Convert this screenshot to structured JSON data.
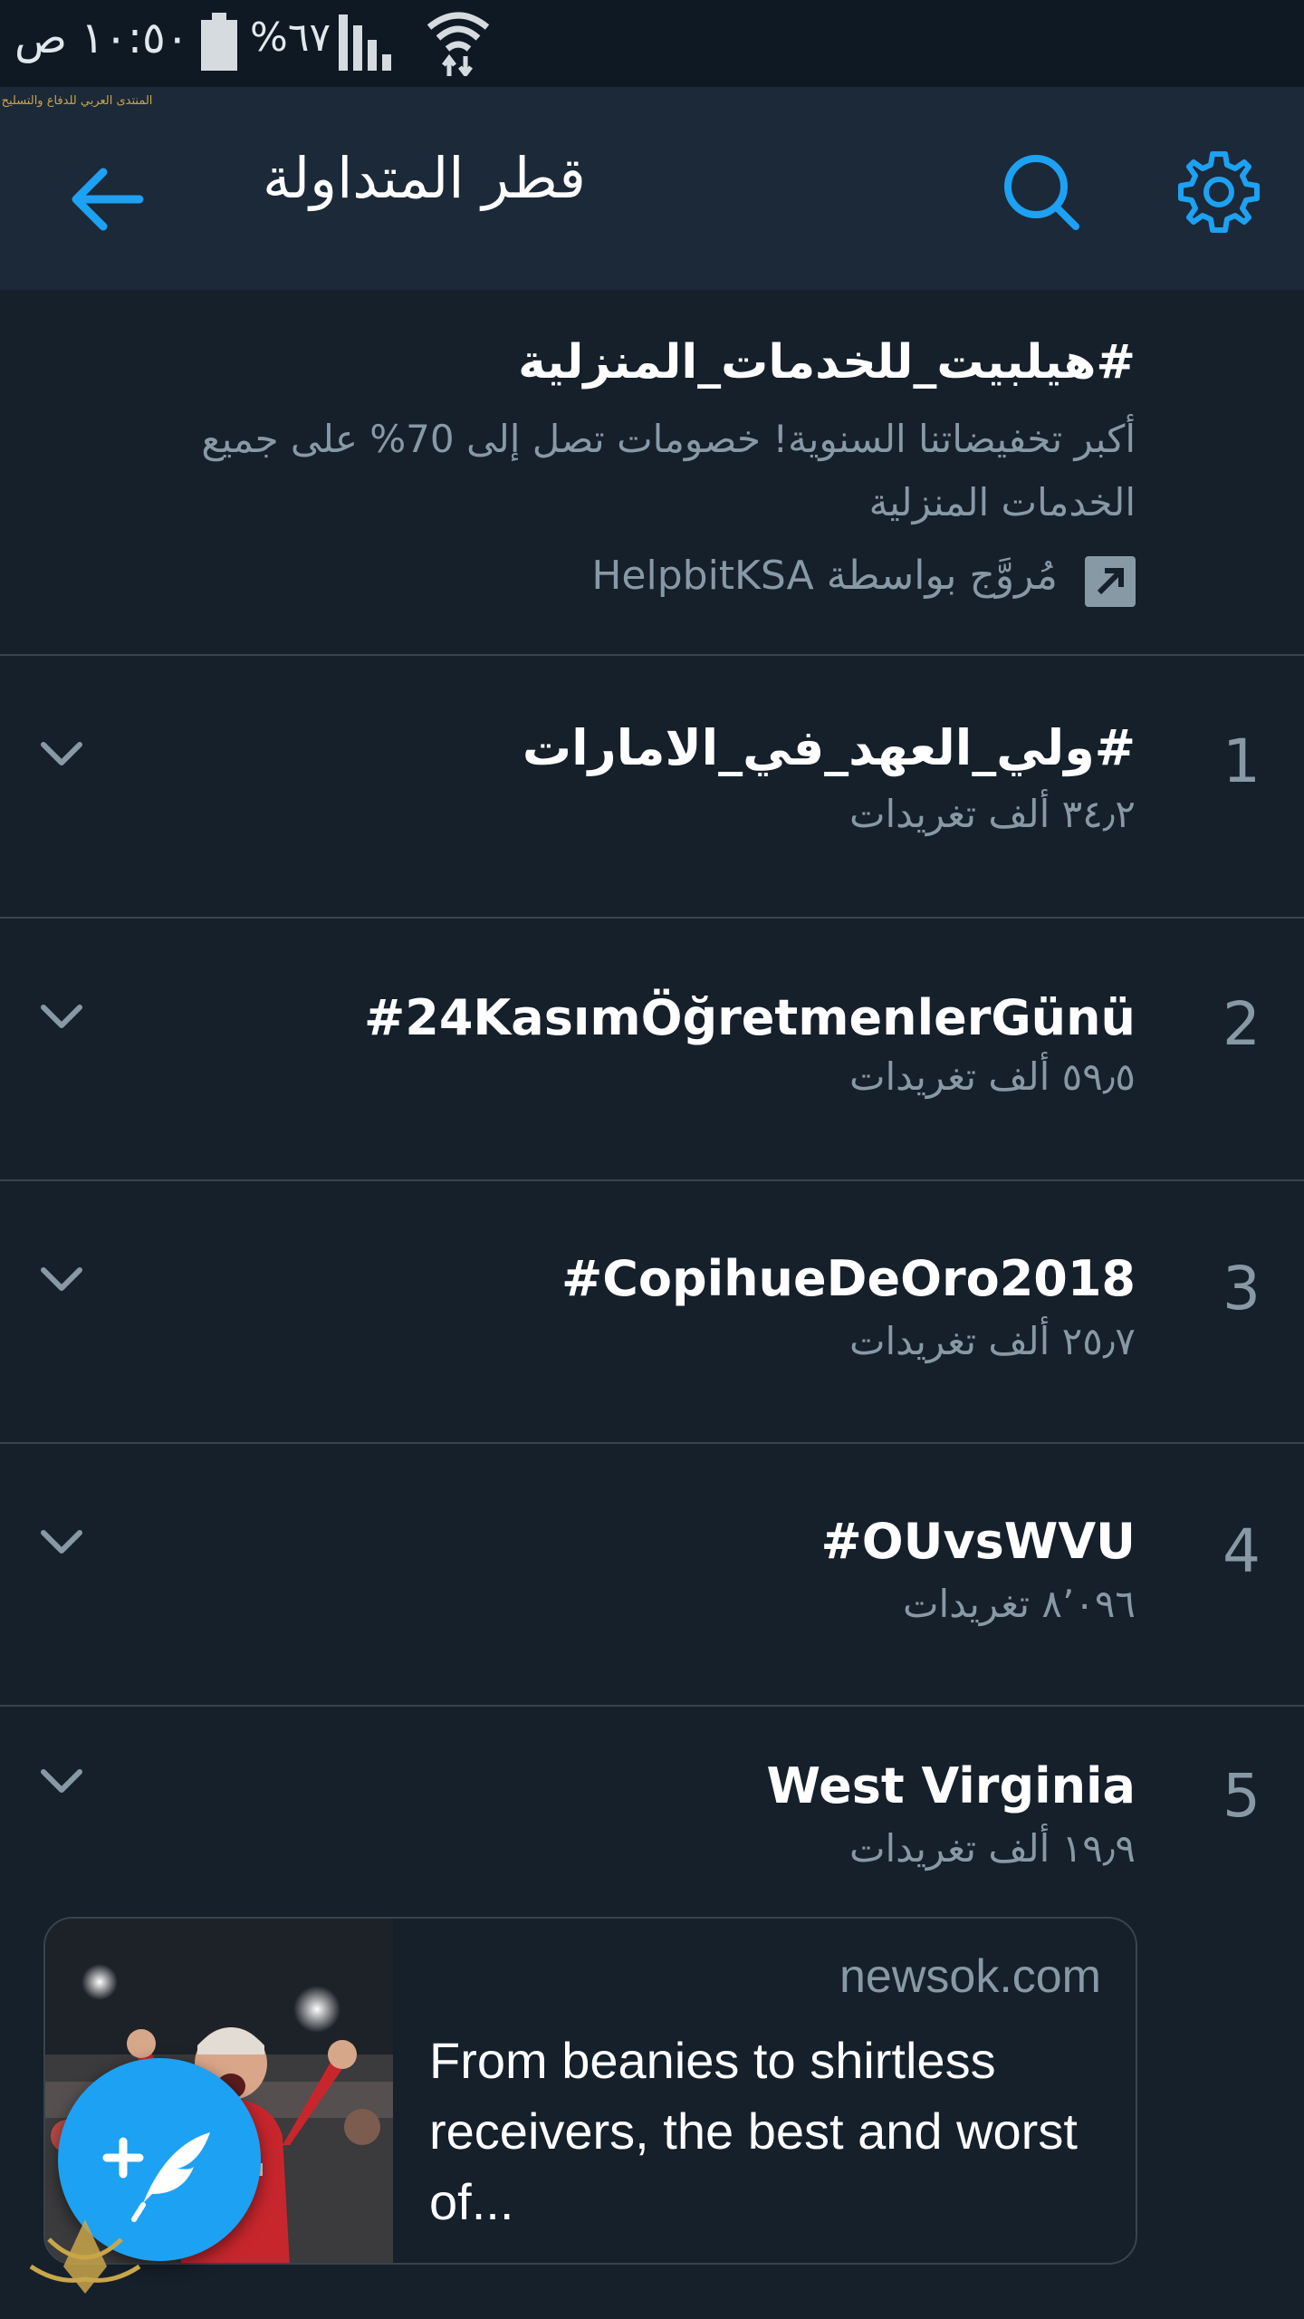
{
  "status_bar": {
    "time": "١٠:٥٠ ص",
    "battery": "%٦٧"
  },
  "header": {
    "title": "قطر المتداولة"
  },
  "promoted": {
    "title": "#هيلبيت_للخدمات_المنزلية",
    "description": "أكبر تخفيضاتنا السنوية! خصومات تصل إلى 70% على جميع الخدمات المنزلية",
    "promoted_by": "مُروَّج بواسطة HelpbitKSA"
  },
  "trends": [
    {
      "rank": "1",
      "name": "#ولي_العهد_في_الامارات",
      "count": "٣٤٫٢ ألف تغريدات"
    },
    {
      "rank": "2",
      "name": "#24KasımÖğretmenlerGünü",
      "count": "٥٩٫٥ ألف تغريدات"
    },
    {
      "rank": "3",
      "name": "#CopihueDeOro2018",
      "count": "٢٥٫٧ ألف تغريدات"
    },
    {
      "rank": "4",
      "name": "#OUvsWVU",
      "count": "٨٬٠٩٦ تغريدات"
    },
    {
      "rank": "5",
      "name": "West Virginia",
      "count": "١٩٫٩ ألف تغريدات"
    }
  ],
  "news_card": {
    "domain": "newsok.com",
    "headline": "From beanies to shirtless receivers, the best and worst of..."
  },
  "watermark": {
    "text": "المنتدى العربي للدفاع والتسليح"
  },
  "colors": {
    "background": "#15202b",
    "header": "#1c2938",
    "accent": "#1da1f2",
    "secondary_text": "#8899a6",
    "divider": "#38444d"
  },
  "icons": {
    "back": "arrow-left-icon",
    "search": "search-icon",
    "settings": "gear-icon",
    "promoted": "promoted-arrow-icon",
    "chevron": "chevron-down-icon",
    "compose": "compose-tweet-icon"
  }
}
